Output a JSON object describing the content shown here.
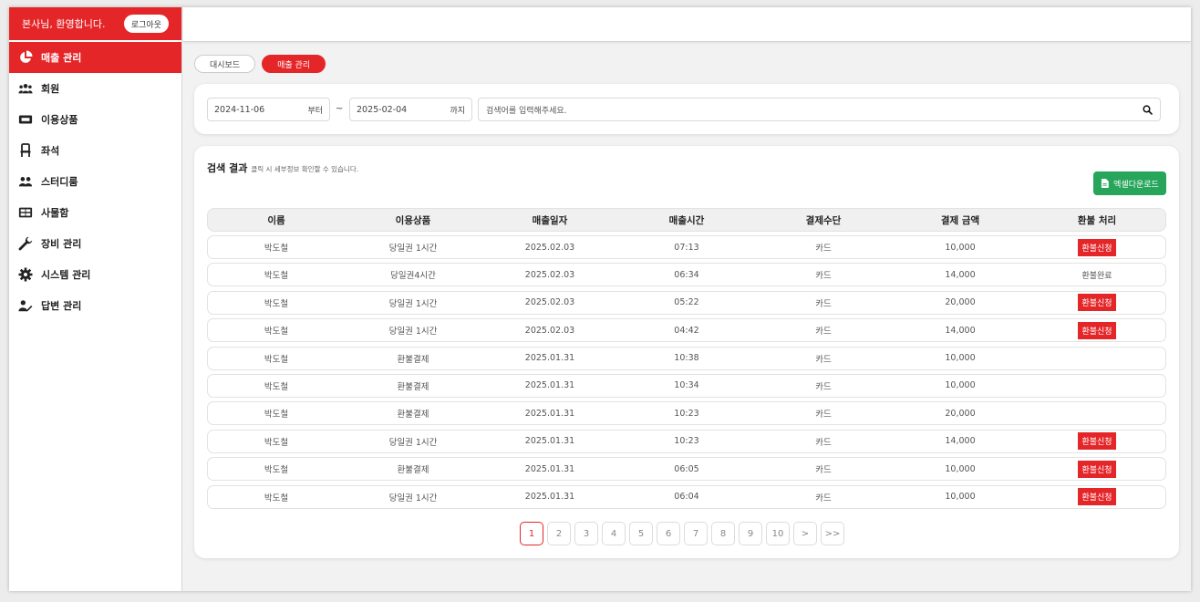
{
  "sidebar": {
    "welcome": "본사님, 환영합니다.",
    "logout_label": "로그아웃",
    "items": [
      {
        "label": "매출 관리",
        "icon": "pie-chart-icon",
        "active": true
      },
      {
        "label": "회원",
        "icon": "users-icon"
      },
      {
        "label": "이용상품",
        "icon": "ticket-icon"
      },
      {
        "label": "좌석",
        "icon": "chair-icon"
      },
      {
        "label": "스터디룸",
        "icon": "group-icon"
      },
      {
        "label": "사물함",
        "icon": "locker-icon"
      },
      {
        "label": "장비 관리",
        "icon": "wrench-icon"
      },
      {
        "label": "시스템 관리",
        "icon": "gear-icon"
      },
      {
        "label": "답변 관리",
        "icon": "user-edit-icon"
      }
    ]
  },
  "tabs": [
    {
      "label": "대시보드",
      "active": false
    },
    {
      "label": "매출 관리",
      "active": true
    }
  ],
  "filters": {
    "start_date": "2024-11-06",
    "start_suffix": "부터",
    "tilde": "~",
    "end_date": "2025-02-04",
    "end_suffix": "까지",
    "search_placeholder": "검색어를 입력해주세요."
  },
  "results": {
    "title": "검색 결과",
    "subtitle": "클릭 시 세부정보 확인할 수 있습니다.",
    "excel_label": "엑셀다운로드"
  },
  "table": {
    "columns": [
      "이름",
      "이용상품",
      "매출일자",
      "매출시간",
      "결제수단",
      "결제 금액",
      "환불 처리"
    ],
    "rows": [
      {
        "name": "박도철",
        "product": "당일권 1시간",
        "date": "2025.02.03",
        "time": "07:13",
        "method": "카드",
        "amount": "10,000",
        "refund": "환불신청",
        "refund_type": "button"
      },
      {
        "name": "박도철",
        "product": "당일권4시간",
        "date": "2025.02.03",
        "time": "06:34",
        "method": "카드",
        "amount": "14,000",
        "refund": "환불완료",
        "refund_type": "text"
      },
      {
        "name": "박도철",
        "product": "당일권 1시간",
        "date": "2025.02.03",
        "time": "05:22",
        "method": "카드",
        "amount": "20,000",
        "refund": "환불신청",
        "refund_type": "button"
      },
      {
        "name": "박도철",
        "product": "당일권 1시간",
        "date": "2025.02.03",
        "time": "04:42",
        "method": "카드",
        "amount": "14,000",
        "refund": "환불신청",
        "refund_type": "button"
      },
      {
        "name": "박도철",
        "product": "환불결제",
        "date": "2025.01.31",
        "time": "10:38",
        "method": "카드",
        "amount": "10,000",
        "refund": "",
        "refund_type": "none"
      },
      {
        "name": "박도철",
        "product": "환불결제",
        "date": "2025.01.31",
        "time": "10:34",
        "method": "카드",
        "amount": "10,000",
        "refund": "",
        "refund_type": "none"
      },
      {
        "name": "박도철",
        "product": "환불결제",
        "date": "2025.01.31",
        "time": "10:23",
        "method": "카드",
        "amount": "20,000",
        "refund": "",
        "refund_type": "none"
      },
      {
        "name": "박도철",
        "product": "당일권 1시간",
        "date": "2025.01.31",
        "time": "10:23",
        "method": "카드",
        "amount": "14,000",
        "refund": "환불신청",
        "refund_type": "button"
      },
      {
        "name": "박도철",
        "product": "환불결제",
        "date": "2025.01.31",
        "time": "06:05",
        "method": "카드",
        "amount": "10,000",
        "refund": "환불신청",
        "refund_type": "button"
      },
      {
        "name": "박도철",
        "product": "당일권 1시간",
        "date": "2025.01.31",
        "time": "06:04",
        "method": "카드",
        "amount": "10,000",
        "refund": "환불신청",
        "refund_type": "button"
      }
    ]
  },
  "pagination": {
    "pages": [
      "1",
      "2",
      "3",
      "4",
      "5",
      "6",
      "7",
      "8",
      "9",
      "10"
    ],
    "current": "1",
    "next": ">",
    "last": ">>"
  },
  "colors": {
    "accent": "#e52629",
    "excel": "#27a55b"
  }
}
